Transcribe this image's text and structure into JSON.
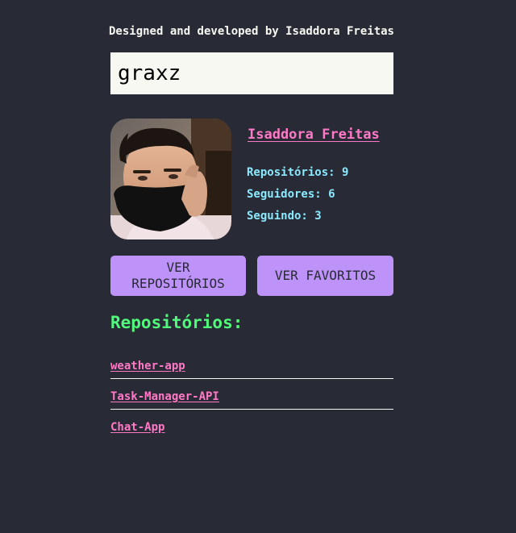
{
  "header": {
    "credit": "Designed and developed by Isaddora Freitas"
  },
  "search": {
    "value": "graxz"
  },
  "profile": {
    "name": "Isaddora Freitas",
    "stats": {
      "repositories": "Repositórios: 9",
      "followers": "Seguidores: 6",
      "following": "Seguindo: 3"
    }
  },
  "actions": {
    "view_repositories": "VER REPOSITÓRIOS",
    "view_favorites": "VER FAVORITOS"
  },
  "repositories": {
    "title": "Repositórios:",
    "items": [
      {
        "name": "weather-app"
      },
      {
        "name": "Task-Manager-API"
      },
      {
        "name": "Chat-App"
      }
    ]
  },
  "colors": {
    "background": "#282a36",
    "input_background": "#f8f8f2",
    "pink": "#ff79c6",
    "cyan": "#8be9fd",
    "purple": "#bd93f9",
    "green": "#50fa7b",
    "foreground": "#f8f8f2"
  }
}
